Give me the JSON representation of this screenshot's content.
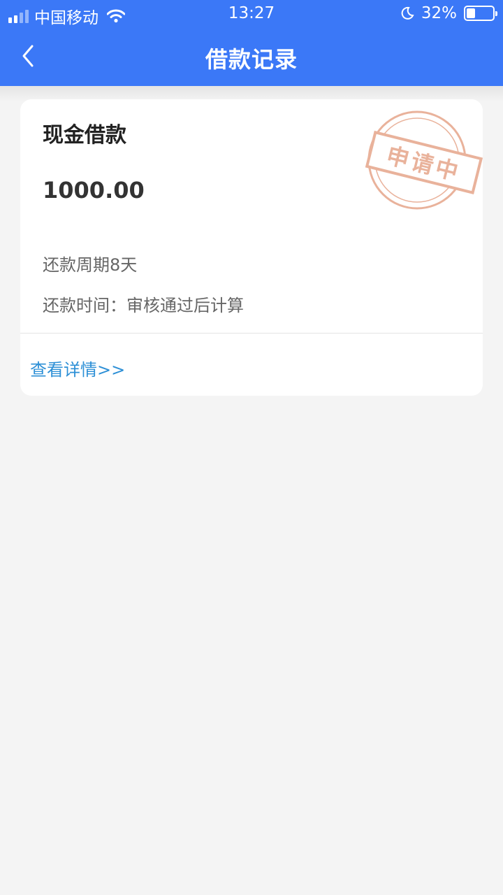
{
  "status_bar": {
    "carrier": "中国移动",
    "time": "13:27",
    "battery": "32%",
    "battery_level": 0.32
  },
  "nav": {
    "title": "借款记录",
    "back_icon": "chevron-left-icon"
  },
  "card": {
    "title": "现金借款",
    "amount": "1000.00",
    "period": "还款周期8天",
    "repay_time": "还款时间：审核通过后计算",
    "detail_link": "查看详情>>",
    "stamp_text": "申请中",
    "stamp_color": "#e6a58a"
  },
  "colors": {
    "primary": "#3b78f7",
    "link": "#2c8fd6",
    "background": "#f4f4f4"
  }
}
